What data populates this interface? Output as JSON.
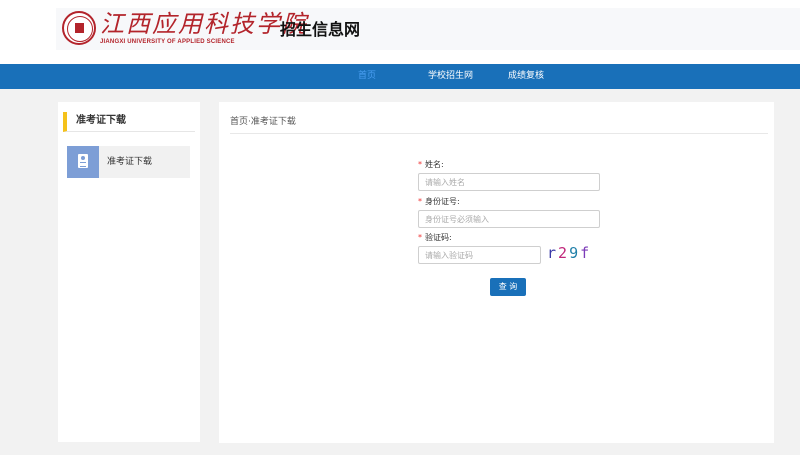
{
  "header": {
    "school_name_cn": "江西应用科技学院",
    "school_name_en": "JIANGXI UNIVERSITY OF APPLIED SCIENCE",
    "site_title": "招生信息网",
    "logo_icon": "school-seal-icon",
    "brand_color": "#b3242b"
  },
  "nav": {
    "items": [
      {
        "label": "首页",
        "active": true
      },
      {
        "label": "学校招生网",
        "active": false
      },
      {
        "label": "成绩复核",
        "active": false
      }
    ],
    "bar_color": "#1970b9"
  },
  "sidebar": {
    "title": "准考证下载",
    "items": [
      {
        "label": "准考证下载",
        "icon": "admission-ticket-icon"
      }
    ],
    "accent_color": "#f5c21b"
  },
  "breadcrumb": {
    "home": "首页",
    "separator": "·",
    "current": "准考证下载"
  },
  "form": {
    "required_mark": "*",
    "name_label": "姓名:",
    "name_placeholder": "请输入姓名",
    "id_label": "身份证号:",
    "id_placeholder": "身份证号必须输入",
    "captcha_label": "验证码:",
    "captcha_placeholder": "请输入验证码",
    "captcha_chars": [
      "r",
      "2",
      "9",
      "f"
    ],
    "submit_label": "查 询"
  }
}
